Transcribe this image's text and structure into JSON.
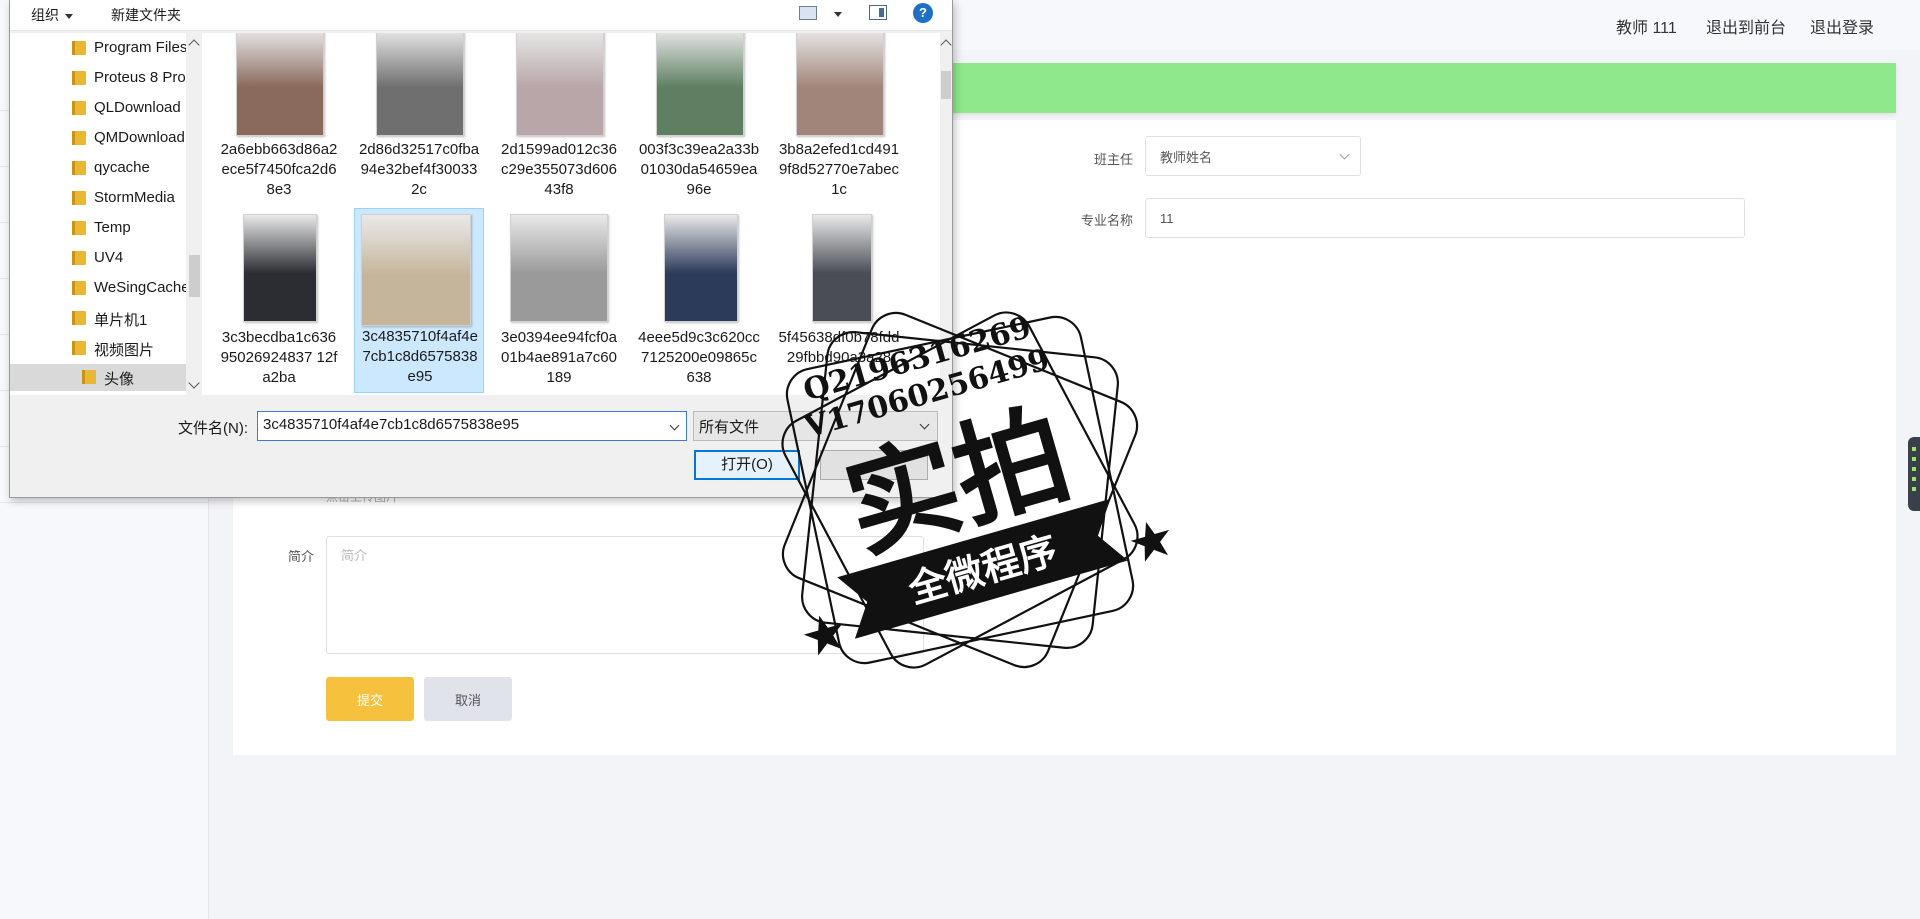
{
  "topbar": {
    "user": "教师 111",
    "to_front": "退出到前台",
    "logout": "退出登录"
  },
  "form": {
    "head_teacher_label": "班主任",
    "head_teacher_value": "教师姓名",
    "major_label": "专业名称",
    "major_value": "11",
    "upload_hint": "点击上传图片",
    "intro_label": "简介",
    "intro_placeholder": "简介",
    "submit": "提交",
    "cancel": "取消"
  },
  "dialog": {
    "organize": "组织",
    "new_folder": "新建文件夹",
    "help": "?",
    "nav_items": [
      {
        "label": "Program Files"
      },
      {
        "label": "Proteus 8 Pro"
      },
      {
        "label": "QLDownload"
      },
      {
        "label": "QMDownload"
      },
      {
        "label": "qycache"
      },
      {
        "label": "StormMedia"
      },
      {
        "label": "Temp"
      },
      {
        "label": "UV4"
      },
      {
        "label": "WeSingCache"
      },
      {
        "label": "单片机1"
      },
      {
        "label": "视频图片"
      },
      {
        "label": "头像"
      }
    ],
    "files": [
      {
        "name": "2a6ebb663d86a2ece5f7450fca2d68e3",
        "color": "#8a6a5c"
      },
      {
        "name": "2d86d32517c0fba94e32bef4f300332c",
        "color": "#6f6f6f"
      },
      {
        "name": "2d1599ad012c36c29e355073d60643f8",
        "color": "#b8a6a8"
      },
      {
        "name": "003f3c39ea2a33b01030da54659ea96e",
        "color": "#5e7f62"
      },
      {
        "name": "3b8a2efed1cd4919f8d52770e7abec1c",
        "color": "#a2857a"
      },
      {
        "name": "3c3becdba1c63695026924837 12fa2ba",
        "color": "#2b2d33"
      },
      {
        "name": "3c4835710f4af4e7cb1c8d6575838e95",
        "color": "#c5b59a"
      },
      {
        "name": "3e0394ee94fcf0a01b4ae891a7c60189",
        "color": "#9a9a9a"
      },
      {
        "name": "4eee5d9c3c620cc7125200e09865c638",
        "color": "#2c3b5a"
      },
      {
        "name": "5f45638df0b78fdd29fbbd90a3a28",
        "color": "#4a4d56"
      }
    ],
    "filename_label": "文件名(N):",
    "filename_value": "3c4835710f4af4e7cb1c8d6575838e95",
    "filetype_value": "所有文件",
    "open_button": "打开(O)"
  },
  "watermark": {
    "line1": "Q2196316269",
    "line2": "V17060256499",
    "big": "实拍",
    "banner": "全微程序"
  }
}
